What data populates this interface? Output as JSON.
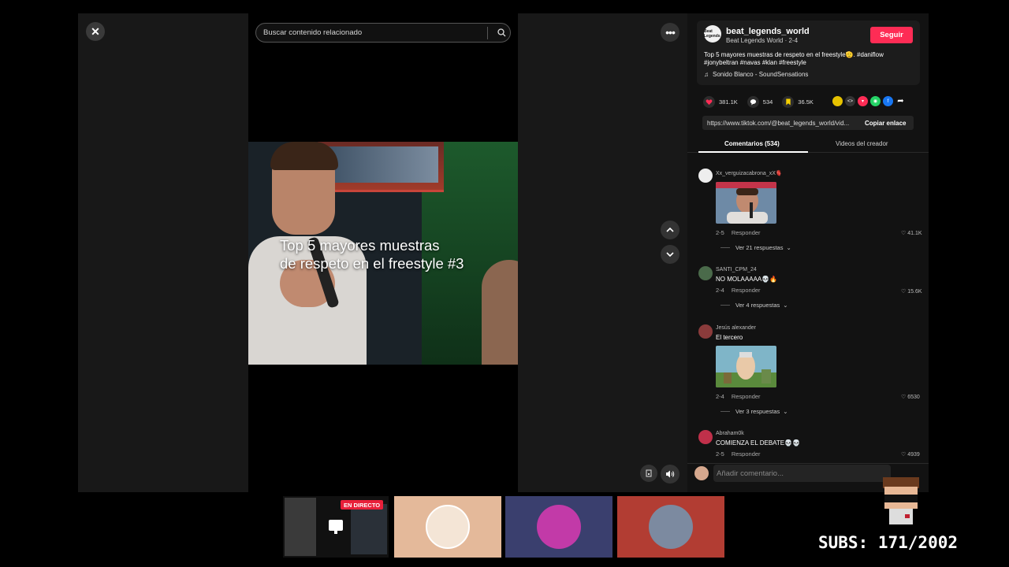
{
  "search": {
    "placeholder": "Buscar contenido relacionado"
  },
  "close_label": "✕",
  "more_label": "•••",
  "video": {
    "caption_line1": "Top 5 mayores muestras",
    "caption_line2": "de respeto en el freestyle #3"
  },
  "creator": {
    "avatar_text": "Beat Legends",
    "handle": "beat_legends_world",
    "subtitle": "Beat Legends World · 2-4",
    "follow_label": "Seguir",
    "description": "Top 5 mayores muestras de respeto en el freestyle🫡. #daniflow #jonybeltran #navas #klan #freestyle",
    "music": "Sonido Blanco - SoundSensations"
  },
  "stats": {
    "likes": "381.1K",
    "comments": "534",
    "saves": "36.5K"
  },
  "share": {
    "link": "https://www.tiktok.com/@beat_legends_world/vid...",
    "copy_label": "Copiar enlace"
  },
  "tabs": {
    "comments": "Comentarios (534)",
    "creator_videos": "Videos del creador"
  },
  "comments": [
    {
      "user": "Xx_verguizacabrona_xX🫀",
      "text": "",
      "date": "2-5",
      "reply": "Responder",
      "likes": "41.1K",
      "replies": "Ver 21 respuestas",
      "has_image": true
    },
    {
      "user": "SANTI_CPM_24",
      "text": "NO MOLAAAAA💀🔥",
      "date": "2-4",
      "reply": "Responder",
      "likes": "15.6K",
      "replies": "Ver 4 respuestas",
      "has_image": false
    },
    {
      "user": "Jesús alexander",
      "text": "El tercero",
      "date": "2-4",
      "reply": "Responder",
      "likes": "6530",
      "replies": "Ver 3 respuestas",
      "has_image": true
    },
    {
      "user": "Abraham0k",
      "text": "COMIENZA EL DEBATE💀💀",
      "date": "2-5",
      "reply": "Responder",
      "likes": "4939",
      "replies": "",
      "has_image": false
    }
  ],
  "comment_input": {
    "placeholder": "Añadir comentario..."
  },
  "overlay": {
    "live_badge": "EN DIRECTO",
    "subs": "SUBS: 171/2002"
  },
  "colors": {
    "accent": "#fe2c55",
    "background": "#000000",
    "panel": "#121212"
  }
}
